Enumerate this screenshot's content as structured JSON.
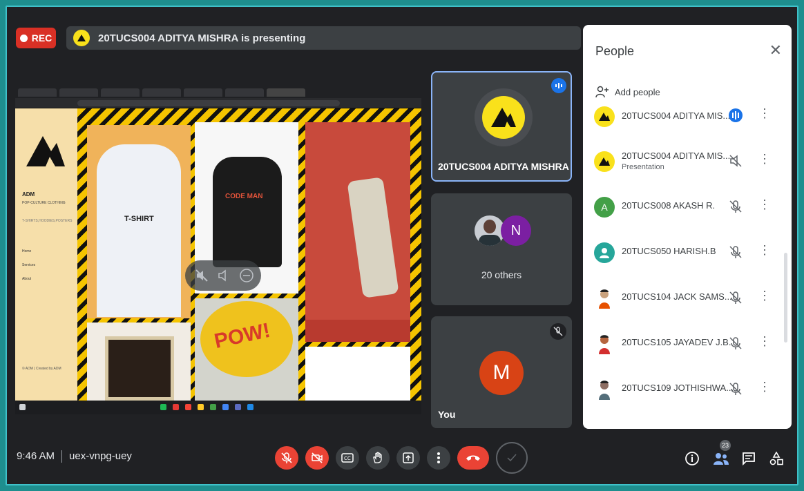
{
  "recording": {
    "label": "REC"
  },
  "presenting": {
    "text": "20TUCS004 ADITYA MISHRA is presenting"
  },
  "shared_screen": {
    "web_brand": "ADM",
    "web_tagline": "POP-CULTURE CLOTHING",
    "web_categories": "T-SHIRTS,HOODIES,POSTERS",
    "web_nav": [
      "Home",
      "Services",
      "About"
    ],
    "web_footer": "© ADM | Created by ADM",
    "tshirt_label": "T-SHIRT",
    "hoodie_label": "CODE MAN",
    "pow_label": "POW!"
  },
  "tiles": {
    "presenter_name": "20TUCS004 ADITYA MISHRA",
    "others_count": "20 others",
    "others_initial": "N",
    "you_initial": "M",
    "you_label": "You"
  },
  "people_panel": {
    "title": "People",
    "add_people": "Add people",
    "participants": [
      {
        "name": "20TUCS004 ADITYA MIS...",
        "sub": "",
        "avatar": "logo",
        "color": "#f9e11b",
        "mic": "active"
      },
      {
        "name": "20TUCS004 ADITYA MIS...",
        "sub": "Presentation",
        "avatar": "logo",
        "color": "#f9e11b",
        "mic": "off-volume"
      },
      {
        "name": "20TUCS008 AKASH R.",
        "sub": "",
        "avatar": "A",
        "color": "#43a047",
        "mic": "off"
      },
      {
        "name": "20TUCS050 HARISH.B",
        "sub": "",
        "avatar": "person",
        "color": "#26a69a",
        "mic": "off"
      },
      {
        "name": "20TUCS104 JACK SAMS...",
        "sub": "",
        "avatar": "photo",
        "color": "#c9a27e",
        "mic": "off"
      },
      {
        "name": "20TUCS105 JAYADEV J.B.",
        "sub": "",
        "avatar": "photo",
        "color": "#b5653f",
        "mic": "off"
      },
      {
        "name": "20TUCS109 JOTHISHWA...",
        "sub": "",
        "avatar": "photo",
        "color": "#8d6e63",
        "mic": "off"
      }
    ]
  },
  "bottom_bar": {
    "time": "9:46 AM",
    "meeting_code": "uex-vnpg-uey",
    "participant_count": "23"
  },
  "colors": {
    "accent": "#8ab4f8",
    "danger": "#ea4335",
    "surface": "#3c4043",
    "background": "#202124"
  }
}
